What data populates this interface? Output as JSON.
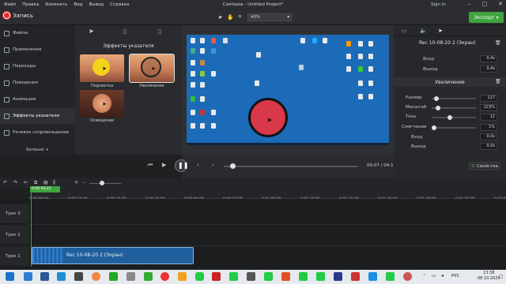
{
  "menu": [
    "Файл",
    "Правка",
    "Изменить",
    "Вид",
    "Вывод",
    "Справка"
  ],
  "window_title": "Camtasia - Untitled Project*",
  "sign_in": "Sign in",
  "toolbar": {
    "record_label": "Запись",
    "zoom_value": "40%",
    "export_label": "Экспорт"
  },
  "left_nav": {
    "items": [
      "Файлы",
      "Применения",
      "Переходы",
      "Поведения",
      "Анимация",
      "Эффекты указателя",
      "Речевое сопровождение"
    ],
    "active_index": 5,
    "more_label": "Больше +"
  },
  "effects": {
    "header": "Эффекты указателя",
    "thumbs": [
      "Подсветка",
      "Увеличение",
      "Освещение"
    ]
  },
  "playback": {
    "current_time": "00:07",
    "total_time": "04:15"
  },
  "properties_panel": {
    "clip_title": "Rec 10-08-20 2 (Экран)",
    "top_rows": [
      {
        "label": "Вход",
        "value": "0,4s"
      },
      {
        "label": "Выход",
        "value": "0,4s"
      }
    ],
    "section_title": "Увеличение",
    "rows": [
      {
        "label": "Размер",
        "value": "127"
      },
      {
        "label": "Масштаб",
        "value": "223%"
      },
      {
        "label": "Тень",
        "value": "12"
      },
      {
        "label": "Смягчение",
        "value": "1%"
      },
      {
        "label": "Вход",
        "value": "0,0s"
      },
      {
        "label": "Выход",
        "value": "0,0s"
      }
    ],
    "properties_label": "Свойства"
  },
  "timeline": {
    "playhead_time": "0:00:00;22",
    "ticks": [
      "0:00:00;00",
      "0:00:10;00",
      "0:00:20;00",
      "0:00:30;00",
      "0:00:40;00",
      "0:00:50;00",
      "0:01:00;00",
      "0:01:10;00",
      "0:01:20;00",
      "0:01:30;00",
      "0:01:40;00",
      "0:01:50;00",
      "0:02:00;00"
    ],
    "tracks": [
      "Трек 3",
      "Трек 2",
      "Трек 1"
    ],
    "clip_label": "Rec 10-08-20 2 (Экран)"
  },
  "taskbar": {
    "lang": "РУС",
    "time": "13:38",
    "date": "08.10.2020"
  }
}
